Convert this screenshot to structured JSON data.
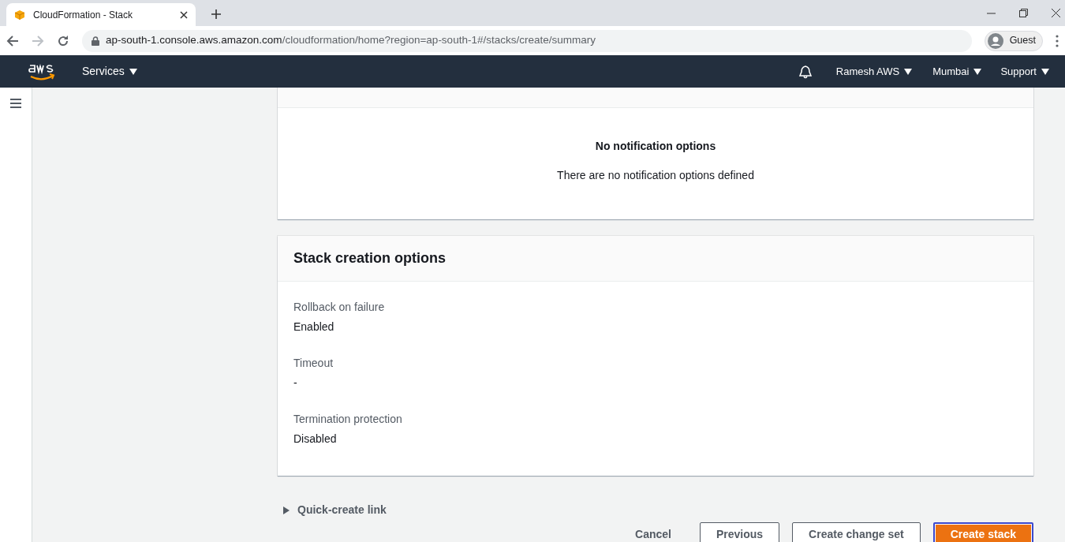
{
  "browser": {
    "tab_title": "CloudFormation - Stack",
    "url_host": "ap-south-1.console.aws.amazon.com",
    "url_path": "/cloudformation/home?region=ap-south-1#/stacks/create/summary",
    "profile": "Guest"
  },
  "console_nav": {
    "services": "Services",
    "user": "Ramesh AWS",
    "region": "Mumbai",
    "support": "Support"
  },
  "sections": [
    {
      "kind": "empty",
      "empty_title": "No notification options",
      "empty_text": "There are no notification options defined"
    },
    {
      "kind": "fields",
      "title": "Stack creation options",
      "fields": [
        {
          "label": "Rollback on failure",
          "value": "Enabled"
        },
        {
          "label": "Timeout",
          "value": "-"
        },
        {
          "label": "Termination protection",
          "value": "Disabled"
        }
      ]
    }
  ],
  "quick_create": {
    "label": "Quick-create link",
    "expanded": false
  },
  "actions": [
    {
      "label": "Cancel",
      "kind": "link"
    },
    {
      "label": "Previous",
      "kind": "secondary"
    },
    {
      "label": "Create change set",
      "kind": "secondary"
    },
    {
      "label": "Create stack",
      "kind": "primary"
    }
  ]
}
